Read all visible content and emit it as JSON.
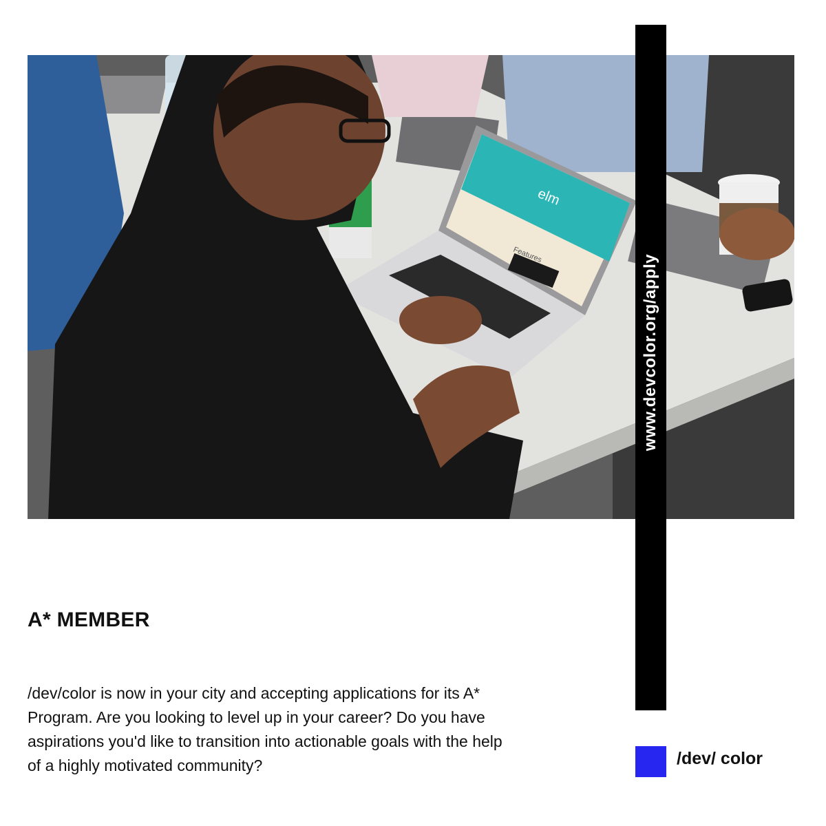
{
  "photo": {
    "subject": "person typing on laptop at workshop table",
    "screen_logo": "elm",
    "screen_heading": "Features"
  },
  "vertical_url": "www.devcolor.org/apply",
  "title": "A* MEMBER",
  "body": "/dev/color is now in your city and accepting applications for its A* Program. Are you looking to level up in your career? Do you have aspirations you'd like to transition into actionable goals with the help of a highly motivated community?",
  "logo": {
    "text": "/dev/ color",
    "accent_color": "#2626f0"
  },
  "colors": {
    "bar": "#000000",
    "accent": "#2626f0",
    "elm_screen": "#2bb5b5"
  }
}
